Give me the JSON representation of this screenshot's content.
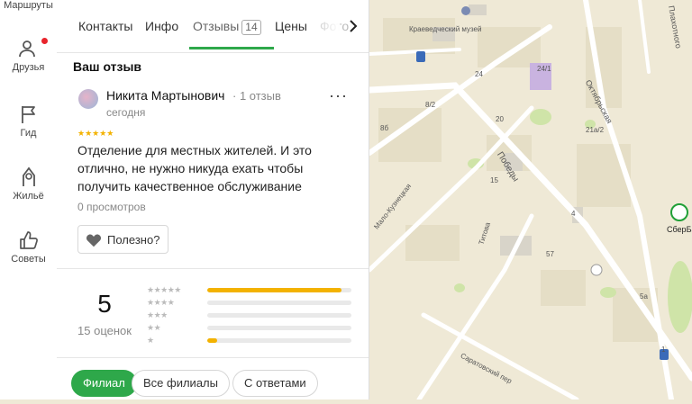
{
  "rail": {
    "routes": "Маршруты",
    "friends": "Друзья",
    "guide": "Гид",
    "housing": "Жильё",
    "tips": "Советы"
  },
  "tabs": {
    "contacts": "Контакты",
    "info": "Инфо",
    "reviews": "Отзывы",
    "reviews_count": "14",
    "prices": "Цены",
    "photos": "Фото"
  },
  "my_review": {
    "title": "Ваш отзыв",
    "author": "Никита Мартынович",
    "author_meta": "· 1 отзыв",
    "date": "сегодня",
    "stars": "★★★★★",
    "text": "Отделение для местных жителей. И это отлично, не нужно никуда ехать чтобы получить качественное обслуживание",
    "views": "0 просмотров",
    "helpful": "Полезно?"
  },
  "rating": {
    "value": "5",
    "count": "15 оценок",
    "distribution": [
      {
        "stars": "★★★★★",
        "fraction": 0.93
      },
      {
        "stars": "★★★★",
        "fraction": 0
      },
      {
        "stars": "★★★",
        "fraction": 0
      },
      {
        "stars": "★★",
        "fraction": 0
      },
      {
        "stars": "★",
        "fraction": 0.07
      }
    ]
  },
  "filters": {
    "branch": "Филиал",
    "all_branches": "Все филиалы",
    "with_replies": "С ответами"
  },
  "colors": {
    "accent": "#2ea84a",
    "star": "#f3b200",
    "notification": "#e8242c"
  },
  "map": {
    "labels": {
      "museum": "Краеведческий музей",
      "oktyabrskaya": "Октябрьская",
      "plakhotnogo": "Плахотного",
      "pobedy": "Победы",
      "malo_kuznetskaya": "Мало-Кузнецкая",
      "titova": "Титова",
      "saratovsky": "Саратовский пер",
      "sberbank": "СберБа",
      "h24": "24",
      "h24_1": "24/1",
      "h8_2": "8/2",
      "h86": "8б",
      "h20": "20",
      "h21a_2": "21а/2",
      "h15": "15",
      "h4": "4",
      "h57": "57",
      "h5a": "5а",
      "h1": "1"
    }
  }
}
